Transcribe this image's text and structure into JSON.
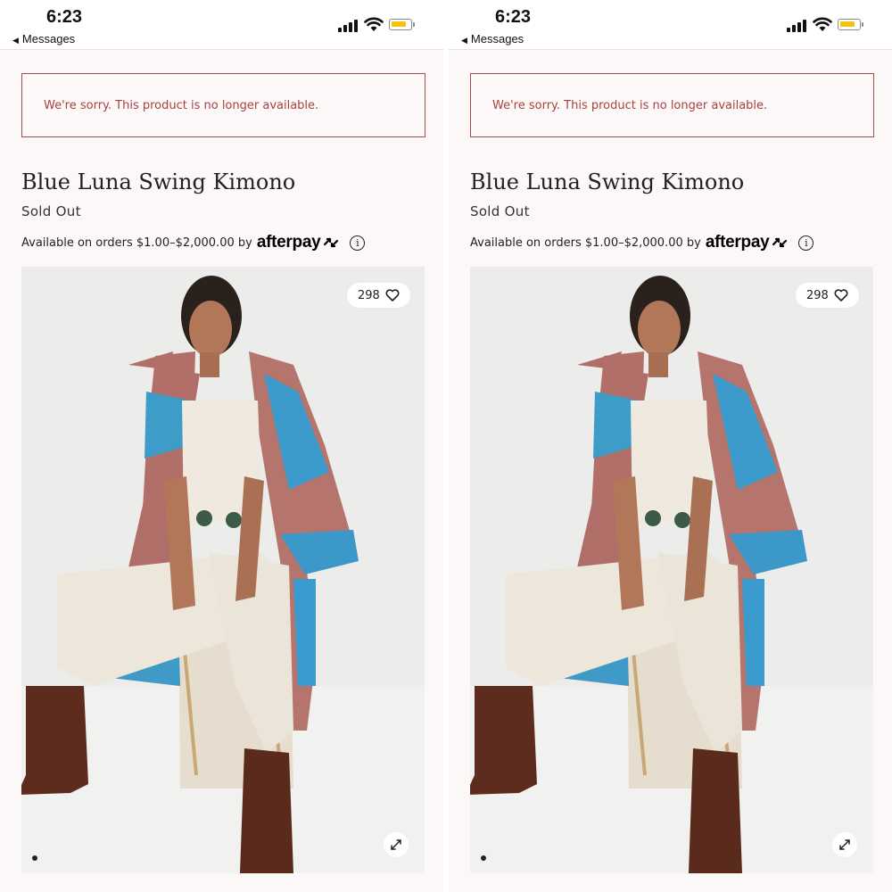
{
  "status_bar": {
    "time": "6:23",
    "back_label": "Messages",
    "battery_color": "#f2c40f"
  },
  "alert": {
    "message": "We're sorry. This product is no longer available.",
    "border_color": "#a84a4a"
  },
  "product": {
    "title": "Blue Luna Swing Kimono",
    "status": "Sold Out",
    "afterpay_text": "Available on orders $1.00–$2,000.00 by",
    "afterpay_brand": "afterpay"
  },
  "gallery": {
    "like_count": "298",
    "icons": [
      "heart-icon",
      "expand-icon",
      "info-icon"
    ]
  }
}
